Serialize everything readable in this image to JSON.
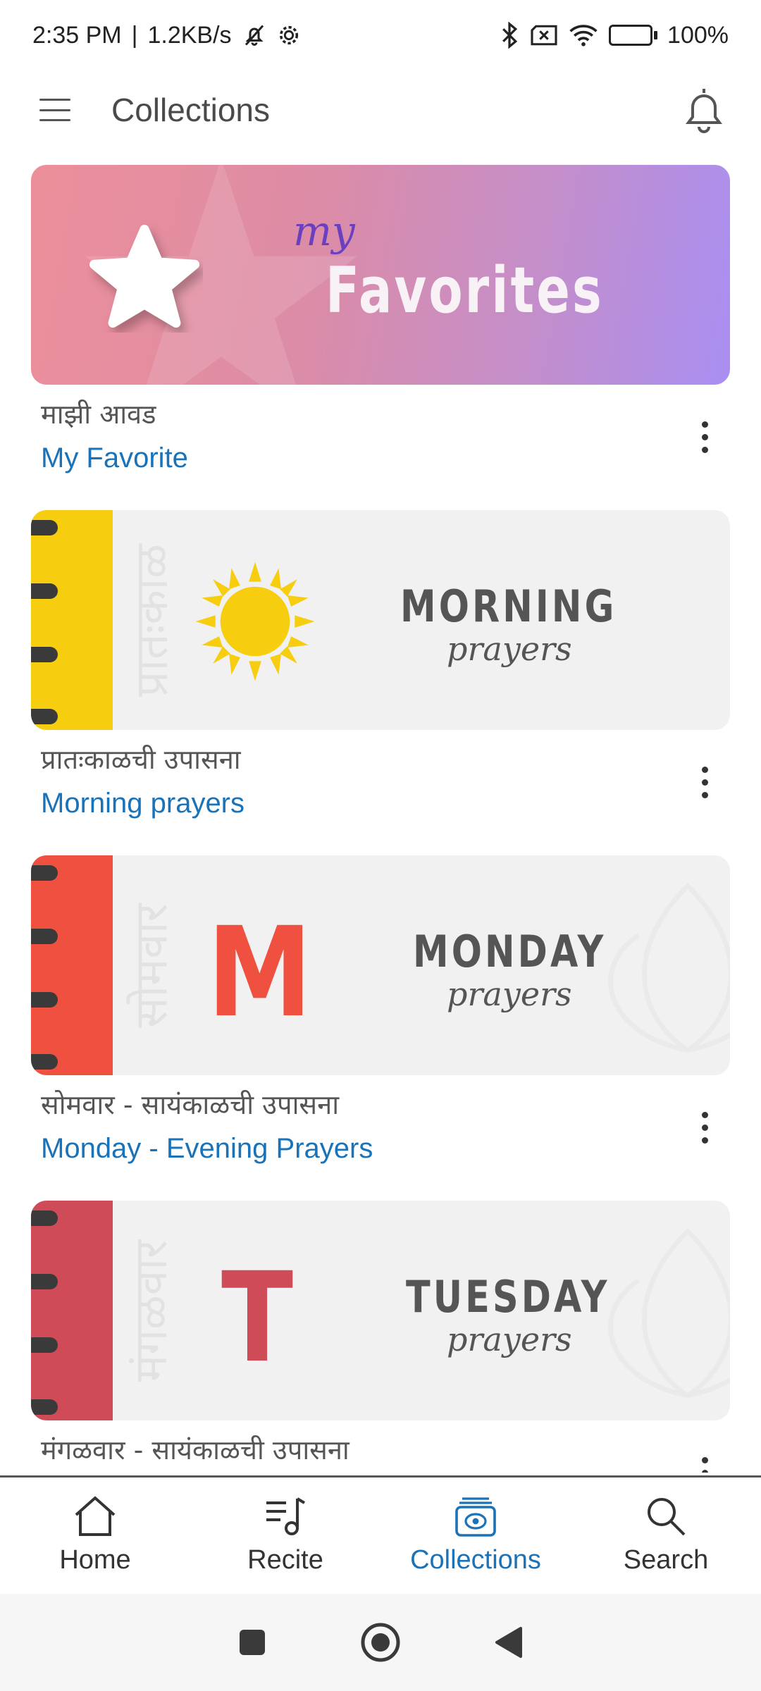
{
  "status_bar": {
    "time": "2:35 PM",
    "network_speed": "1.2KB/s",
    "battery": "100%",
    "battery_level": 1.0,
    "icons": [
      "mute-bell-icon",
      "gear-icon",
      "bluetooth-icon",
      "sim-x-icon",
      "wifi-icon",
      "battery-charging-icon"
    ]
  },
  "app_bar": {
    "title": "Collections",
    "menu_icon": "hamburger-menu-icon",
    "notification_icon": "bell-icon"
  },
  "banners": {
    "favorites": {
      "small": "my",
      "large": "Favorites"
    },
    "morning": {
      "heading": "MORNING",
      "sub": "prayers",
      "vertical": "प्रातःकाळ"
    },
    "monday": {
      "heading": "MONDAY",
      "sub": "prayers",
      "letter": "M",
      "vertical": "सोमवार"
    },
    "tuesday": {
      "heading": "TUESDAY",
      "sub": "prayers",
      "letter": "T",
      "vertical": "मंगळवार"
    }
  },
  "collections": [
    {
      "title_mr": "माझी आवड",
      "title_en": "My Favorite"
    },
    {
      "title_mr": "प्रातःकाळची उपासना",
      "title_en": "Morning prayers"
    },
    {
      "title_mr": "सोमवार - सायंकाळची उपासना",
      "title_en": "Monday - Evening Prayers"
    },
    {
      "title_mr": "मंगळवार - सायंकाळची उपासना",
      "title_en": ""
    }
  ],
  "colors": {
    "accent": "#1a73b8",
    "morning_strip": "#f6cd0f",
    "monday_strip": "#f0503f",
    "tuesday_strip": "#cf4b58"
  },
  "bottom_nav": {
    "items": [
      {
        "label": "Home",
        "icon": "home-icon",
        "active": false
      },
      {
        "label": "Recite",
        "icon": "music-list-icon",
        "active": false
      },
      {
        "label": "Collections",
        "icon": "collections-icon",
        "active": true
      },
      {
        "label": "Search",
        "icon": "search-icon",
        "active": false
      }
    ]
  },
  "system_nav": {
    "icons": [
      "recents-square-icon",
      "home-circle-icon",
      "back-triangle-icon"
    ]
  }
}
